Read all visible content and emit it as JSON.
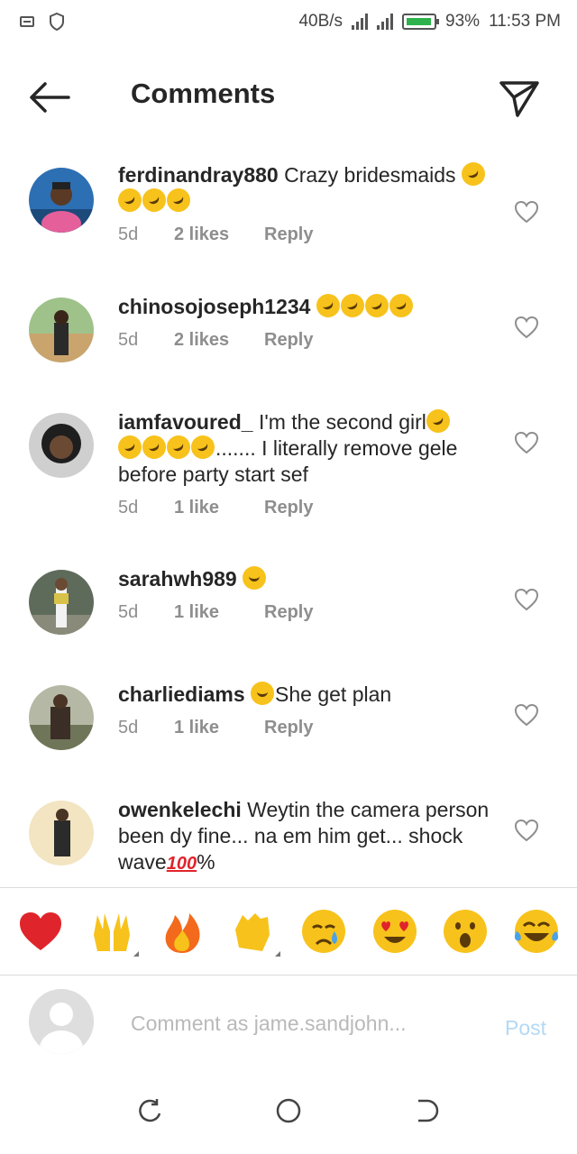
{
  "status_bar": {
    "speed": "40B/s",
    "battery": "93%",
    "time": "11:53 PM"
  },
  "header": {
    "title": "Comments",
    "back_icon": "arrow-left-icon",
    "send_icon": "paper-plane-icon"
  },
  "comments": [
    {
      "username": "ferdinandray880",
      "text": "Crazy bridesmaids",
      "emoji_count": 4,
      "time": "5d",
      "likes": "2 likes",
      "reply": "Reply"
    },
    {
      "username": "chinosojoseph1234",
      "text": "",
      "emoji_count": 4,
      "time": "5d",
      "likes": "2 likes",
      "reply": "Reply"
    },
    {
      "username": "iamfavoured_",
      "text": "I'm the second girl",
      "text2": "....... I literally remove gele before party start sef",
      "time": "5d",
      "likes": "1 like",
      "reply": "Reply"
    },
    {
      "username": "sarahwh989",
      "text": "",
      "time": "5d",
      "likes": "1 like",
      "reply": "Reply"
    },
    {
      "username": "charliediams",
      "text": "She get plan",
      "time": "5d",
      "likes": "1 like",
      "reply": "Reply"
    },
    {
      "username": "owenkelechi",
      "text": "Weytin the camera person been dy fine... na em him get... shock wave",
      "suffix": "%",
      "hundred": "100"
    }
  ],
  "quick_emojis": [
    "red-heart",
    "raising-hands",
    "fire",
    "clapping-hands",
    "crying-face",
    "heart-eyes",
    "surprised-face",
    "tears-of-joy"
  ],
  "composer": {
    "placeholder": "Comment as jame.sandjohn...",
    "post_label": "Post"
  },
  "colors": {
    "text": "#262626",
    "meta": "#8e8e8e",
    "post_disabled": "#b3d9f5",
    "divider": "#dbdbdb"
  }
}
